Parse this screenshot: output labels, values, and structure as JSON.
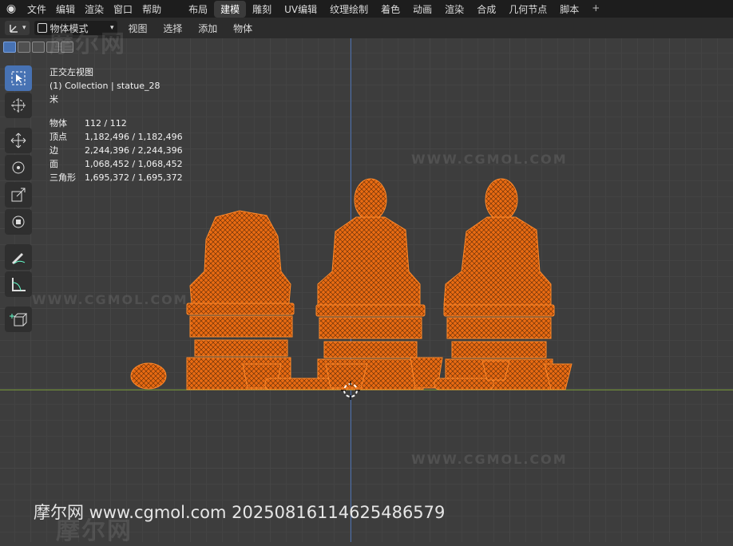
{
  "topbar": {
    "menu": [
      "文件",
      "编辑",
      "渲染",
      "窗口",
      "帮助"
    ],
    "tabs": [
      "布局",
      "建模",
      "雕刻",
      "UV编辑",
      "纹理绘制",
      "着色",
      "动画",
      "渲染",
      "合成",
      "几何节点",
      "脚本"
    ],
    "active_tab": "建模",
    "plus": "+"
  },
  "header": {
    "mode": "物体模式",
    "menu": [
      "视图",
      "选择",
      "添加",
      "物体"
    ]
  },
  "overlay": {
    "view_name": "正交左视图",
    "collection": "(1) Collection | statue_28",
    "units": "米",
    "stats": [
      {
        "label": "物体",
        "value": "112 / 112"
      },
      {
        "label": "顶点",
        "value": "1,182,496 / 1,182,496"
      },
      {
        "label": "边",
        "value": "2,244,396 / 2,244,396"
      },
      {
        "label": "面",
        "value": "1,068,452 / 1,068,452"
      },
      {
        "label": "三角形",
        "value": "1,695,372 / 1,695,372"
      }
    ]
  },
  "watermarks": {
    "site": "WWW.CGMOL.COM",
    "brand": "摩尔网"
  },
  "footer": "摩尔网 www.cgmol.com 20250816114625486579",
  "colors": {
    "accent": "#4772b3",
    "selection_orange": "#ff7a1a",
    "x_axis": "#7a9a3a",
    "z_axis": "#4a6fb0"
  },
  "icons": [
    "select-box-icon",
    "cursor-icon",
    "move-icon",
    "rotate-icon",
    "scale-icon",
    "transform-icon",
    "annotate-icon",
    "measure-icon",
    "add-cube-icon"
  ]
}
